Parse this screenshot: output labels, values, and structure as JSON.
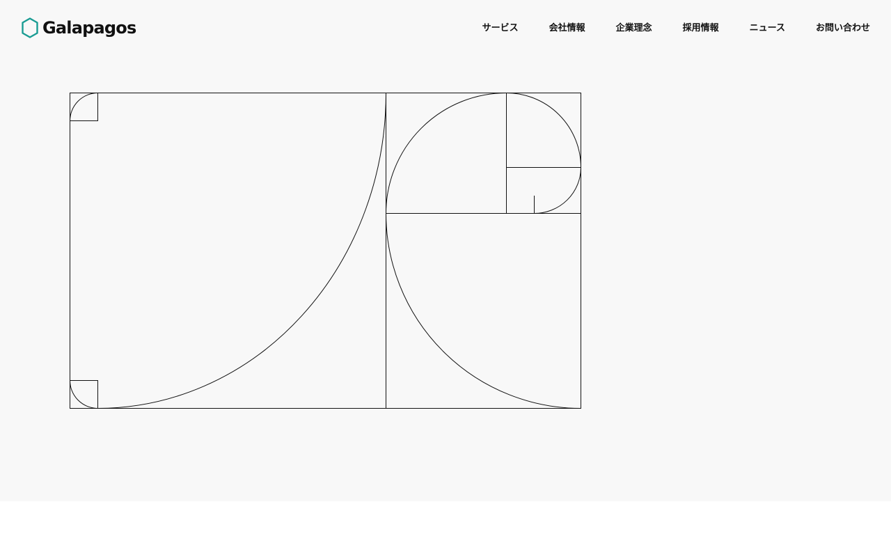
{
  "brand": {
    "name": "Galapagos",
    "accent_color": "#1a9c93"
  },
  "nav": {
    "items": [
      {
        "label": "サービス"
      },
      {
        "label": "会社情報"
      },
      {
        "label": "企業理念"
      },
      {
        "label": "採用情報"
      },
      {
        "label": "ニュース"
      },
      {
        "label": "お問い合わせ"
      }
    ]
  },
  "hero": {
    "illustration_icon": "golden-spiral-illustration",
    "background_color": "#f8f8f8"
  }
}
